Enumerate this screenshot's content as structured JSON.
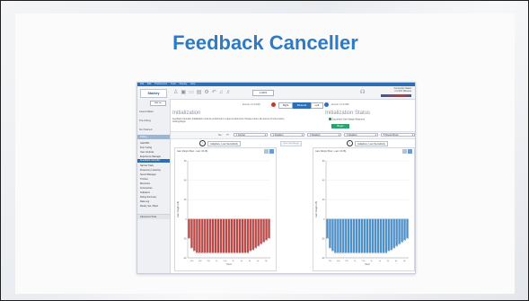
{
  "slide": {
    "title": "Feedback Canceller"
  },
  "menubar": {
    "items": [
      "File",
      "Edit",
      "Preferences",
      "Tools",
      "Display",
      "Help"
    ],
    "right_text": "Connection Status"
  },
  "toolbar": {
    "logo": "Starkey",
    "field_value": "a 0001",
    "status_title": "Connection Status",
    "status_sub": "2.4 GHz Wireless"
  },
  "sidebar": {
    "small_button": "Add Ion",
    "sections": [
      "Latest Mkaw",
      "Pre-Fitting",
      "Get Started"
    ],
    "fitting_header": "Fitting",
    "items": [
      "Gain/SPL",
      "Fine Tuning",
      "User Controls",
      "Experience Manager",
      "Feedback Canceller",
      "Narrow Track",
      "Frequency Lowering",
      "Sound Manager",
      "Tinnitus",
      "Memories",
      "Accessories",
      "Indicators",
      "Fitting Summary",
      "Data Log",
      "Ready, Set, Fitted"
    ],
    "active_item": "Feedback Canceller",
    "footer": "Advanced Tools"
  },
  "ear_select": {
    "left_label": "Exotic AI 2400i",
    "right_label": "Exotic AI 2400i",
    "buttons": [
      "Right",
      "Binaural",
      "Left"
    ],
    "selected": "Binaural",
    "left_color": "#c0392b",
    "right_color": "#2d6fb7"
  },
  "initialization": {
    "heading": "Initialization",
    "description": "Feedback Canceller Initialization must be performed in a quiet environment. Please reduce all sources of noise before clicking Begin.",
    "status_heading": "Initialization Status",
    "status_text": "Successful Gain Margin Measured",
    "begin_label": "Begin"
  },
  "memories": {
    "label": "No.",
    "slots": [
      "1 Normal",
      "2 Disabled",
      "3 Disabled",
      "4 Disabled",
      "5 Stream Boost"
    ]
  },
  "method": {
    "left": "Adaptive, Low Sensitivity",
    "right": "Adaptive, Low Sensitivity",
    "center_button": "Clear Gain Margin",
    "circle": "i"
  },
  "charts": [
    {
      "header": "Gain Margin (Best - Last: 18 dB)",
      "bar_color": "#b84a48",
      "face_color": "#b84a48"
    },
    {
      "header": "Gain Margin (Best - Last: 18 dB)",
      "bar_color": "#4f8fc8",
      "face_color": "#4f8fc8"
    }
  ],
  "chart_data": [
    {
      "type": "bar",
      "title": "Gain Margin",
      "xlabel": "Hertz",
      "ylabel": "Gain Margin (dB)",
      "ylim": [
        -40,
        60
      ],
      "x_ticks": [
        "250",
        "500",
        "750",
        "1k",
        "1.5k",
        "2k",
        "3k",
        "4k",
        "6k",
        "8k"
      ],
      "y_ticks": [
        "60",
        "40",
        "20",
        "0",
        "-20",
        "-40"
      ],
      "values": [
        -20,
        -30,
        -33,
        -35,
        -35,
        -35,
        -35,
        -35,
        -35,
        -35,
        -35,
        -35,
        -35,
        -35,
        -35,
        -35,
        -35,
        -35,
        -35,
        -35,
        -35,
        -35,
        -35,
        -33,
        -32,
        -30,
        -28,
        -26,
        -24,
        -22,
        -20
      ],
      "series_color": "#b84a48"
    },
    {
      "type": "bar",
      "title": "Gain Margin",
      "xlabel": "Hertz",
      "ylabel": "Gain Margin (dB)",
      "ylim": [
        -40,
        60
      ],
      "x_ticks": [
        "250",
        "500",
        "750",
        "1k",
        "1.5k",
        "2k",
        "3k",
        "4k",
        "6k",
        "8k"
      ],
      "y_ticks": [
        "60",
        "40",
        "20",
        "0",
        "-20",
        "-40"
      ],
      "values": [
        -20,
        -30,
        -33,
        -35,
        -35,
        -35,
        -35,
        -35,
        -35,
        -35,
        -35,
        -35,
        -35,
        -35,
        -35,
        -35,
        -35,
        -35,
        -35,
        -35,
        -35,
        -35,
        -35,
        -33,
        -32,
        -30,
        -28,
        -26,
        -24,
        -22,
        -20
      ],
      "series_color": "#4f8fc8"
    }
  ]
}
